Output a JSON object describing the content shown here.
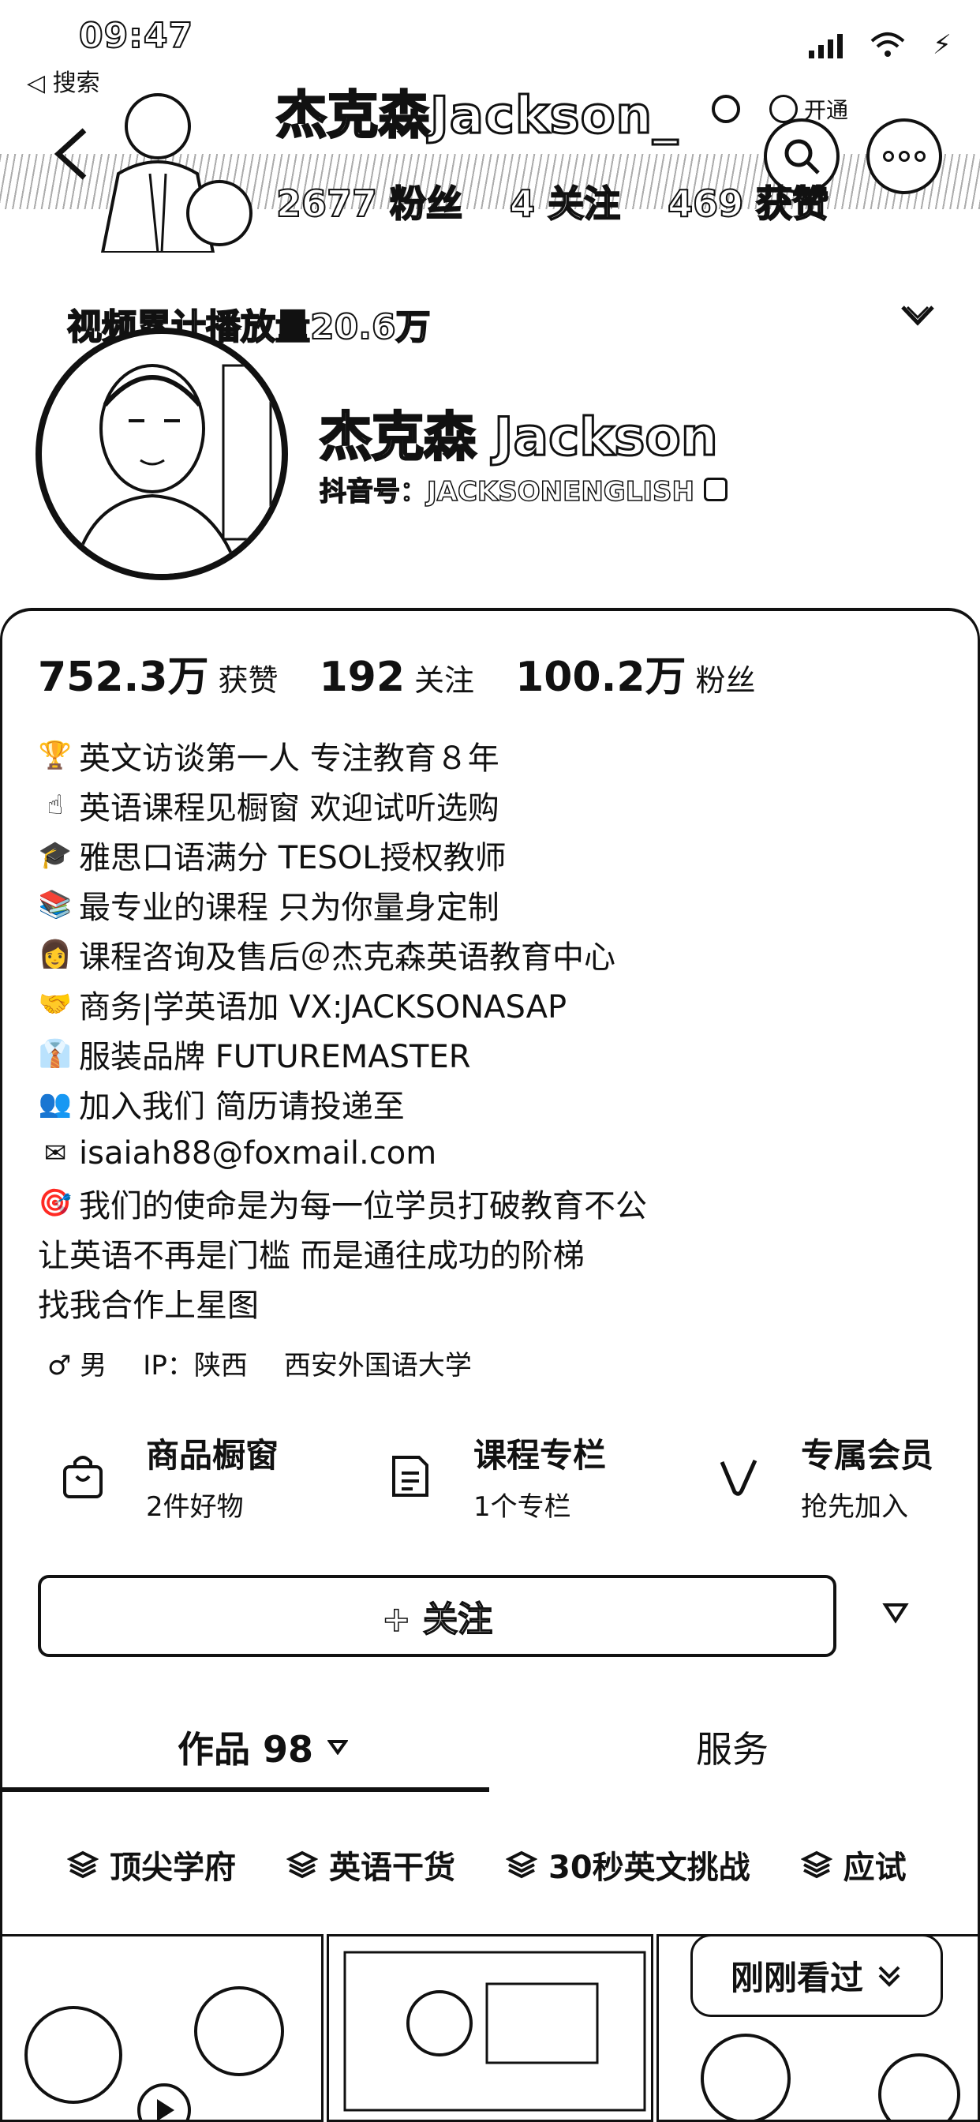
{
  "status_bar": {
    "time": "09:47",
    "back_label": "◁ 搜索"
  },
  "header": {
    "top_name": "杰克森Jackson_",
    "open_label": "开通",
    "stats": {
      "fans": "2677 粉丝",
      "following": "4 关注",
      "likes": "469 获赞"
    },
    "views_badge": "视频累计播放量20.6万"
  },
  "profile": {
    "name": "杰克森 Jackson",
    "douyin_id": "抖音号：JACKSONENGLISH"
  },
  "counts": [
    {
      "num": "752.3万",
      "label": "获赞"
    },
    {
      "num": "192",
      "label": "关注"
    },
    {
      "num": "100.2万",
      "label": "粉丝"
    }
  ],
  "bio": [
    {
      "icon": "trophy-icon",
      "glyph": "🏆",
      "text": "英文访谈第一人 专注教育８年"
    },
    {
      "icon": "pointing-hand-icon",
      "glyph": "☝",
      "text": "英语课程见橱窗 欢迎试听选购"
    },
    {
      "icon": "graduation-cap-icon",
      "glyph": "🎓",
      "text": "雅思口语满分 TESOL授权教师"
    },
    {
      "icon": "books-icon",
      "glyph": "📚",
      "text": "最专业的课程 只为你量身定制"
    },
    {
      "icon": "person-icon",
      "glyph": "👩",
      "text": "课程咨询及售后＠杰克森英语教育中心"
    },
    {
      "icon": "handshake-icon",
      "glyph": "🤝",
      "text": "商务|学英语加 VX:JACKSONASAP"
    },
    {
      "icon": "shirt-icon",
      "glyph": "👔",
      "text": "服装品牌 FUTUREMASTER"
    },
    {
      "icon": "people-icon",
      "glyph": "👥",
      "text": "加入我们 简历请投递至"
    },
    {
      "icon": "envelope-icon",
      "glyph": "✉",
      "text": "isaiah88@foxmail.com"
    },
    {
      "icon": "target-icon",
      "glyph": "🎯",
      "text": "我们的使命是为每一位学员打破教育不公"
    },
    {
      "icon": "",
      "glyph": "",
      "text": "让英语不再是门槛 而是通往成功的阶梯"
    },
    {
      "icon": "",
      "glyph": "",
      "text": "找我合作上星图"
    }
  ],
  "meta": {
    "gender": "♂ 男",
    "ip": "IP：陕西",
    "school": "西安外国语大学"
  },
  "shortcuts": [
    {
      "icon": "shopping-bag-icon",
      "title": "商品橱窗",
      "sub": "2件好物"
    },
    {
      "icon": "document-icon",
      "title": "课程专栏",
      "sub": "1个专栏"
    },
    {
      "icon": "v-badge-icon",
      "title": "专属会员",
      "sub": "抢先加入"
    }
  ],
  "follow_label": "+ 关注",
  "tabs": {
    "works": "作品 98",
    "services": "服务"
  },
  "chips": [
    "顶尖学府",
    "英语干货",
    "30秒英文挑战",
    "应试"
  ],
  "recent_label": "刚刚看过"
}
